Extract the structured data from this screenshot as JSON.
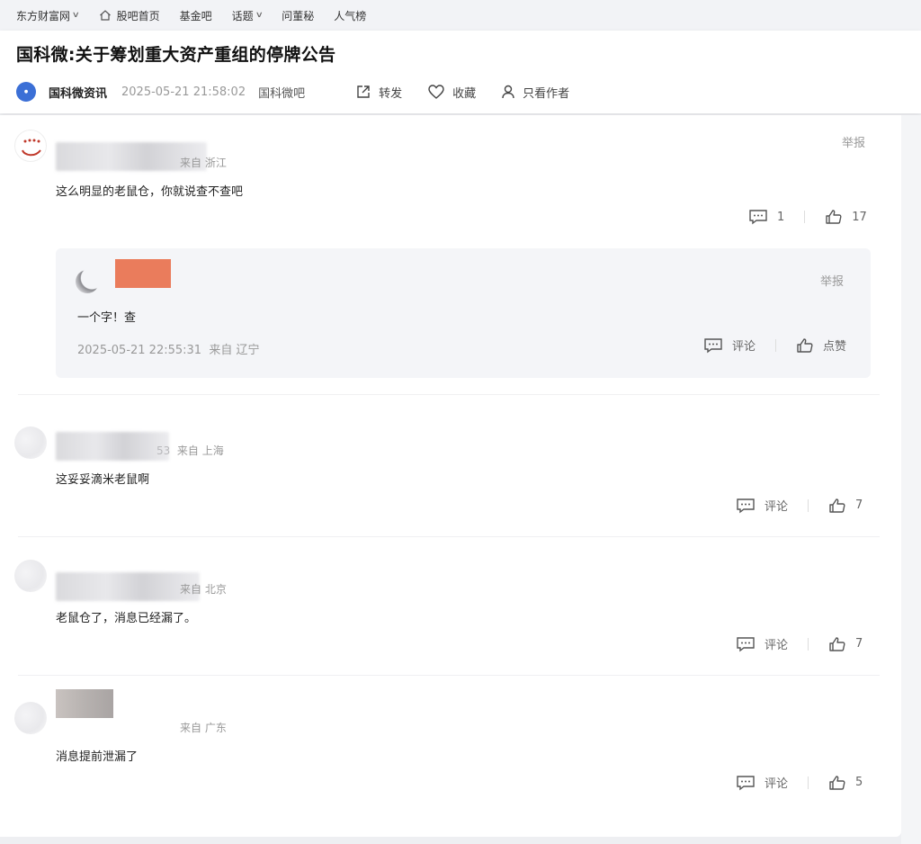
{
  "topnav": {
    "items": [
      {
        "label": "东方财富网",
        "dropdown": true
      },
      {
        "label": "股吧首页",
        "icon": "home-icon"
      },
      {
        "label": "基金吧"
      },
      {
        "label": "话题",
        "dropdown": true
      },
      {
        "label": "问董秘"
      },
      {
        "label": "人气榜"
      }
    ]
  },
  "post": {
    "title": "国科微:关于筹划重大资产重组的停牌公告",
    "author": "国科微资讯",
    "time": "2025-05-21 21:58:02",
    "bar": "国科微吧",
    "actions": {
      "share": "转发",
      "favorite": "收藏",
      "author_only": "只看作者"
    }
  },
  "comments": [
    {
      "location": "来自 浙江",
      "report": "举报",
      "text": "这么明显的老鼠仓，你就说查不查吧",
      "comment_count": "1",
      "like_count": "17",
      "reply": {
        "report": "举报",
        "text": "一个字！查",
        "time": "2025-05-21 22:55:31",
        "location": "来自 辽宁",
        "comment_label": "评论",
        "like_label": "点赞"
      }
    },
    {
      "location_prefix": "53",
      "location": "来自 上海",
      "text": "这妥妥滴米老鼠啊",
      "comment_label": "评论",
      "like_count": "7"
    },
    {
      "location": "来自 北京",
      "text": "老鼠仓了，消息已经漏了。",
      "comment_label": "评论",
      "like_count": "7"
    },
    {
      "location": "来自 广东",
      "text": "消息提前泄漏了",
      "comment_label": "评论",
      "like_count": "5"
    }
  ],
  "colors": {
    "accent_orange": "#ea7c5c",
    "avatar_blue": "#3b6fd6"
  }
}
